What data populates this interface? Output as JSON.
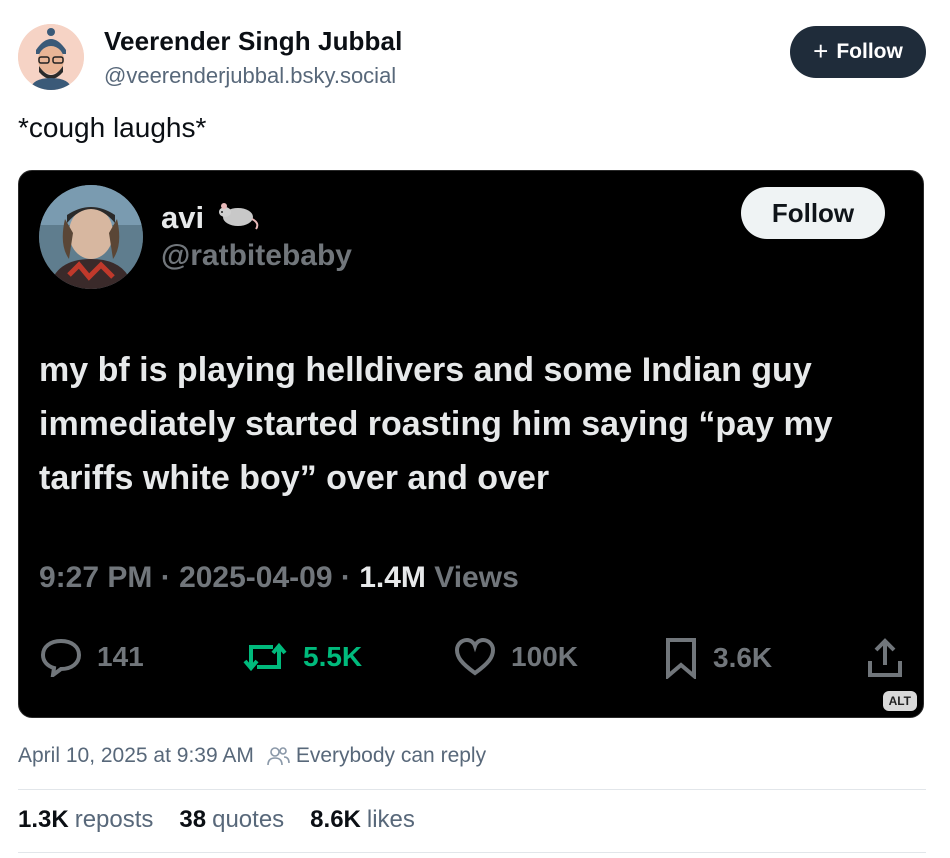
{
  "author": {
    "display_name": "Veerender Singh Jubbal",
    "handle": "@veerenderjubbal.bsky.social",
    "follow_label": "Follow"
  },
  "post": {
    "text": "*cough laughs*",
    "timestamp": "April 10, 2025 at 9:39 AM",
    "reply_setting": "Everybody can reply"
  },
  "embedded_tweet": {
    "name": "avi",
    "handle": "@ratbitebaby",
    "follow_label": "Follow",
    "text": "my bf is playing helldivers and some Indian guy immediately started roasting him saying “pay my tariffs white boy” over and over",
    "time": "9:27 PM",
    "date": "2025-04-09",
    "views_count": "1.4M",
    "views_label": "Views",
    "replies": "141",
    "reposts": "5.5K",
    "likes": "100K",
    "bookmarks": "3.6K",
    "alt_badge": "ALT",
    "colors": {
      "repost_green": "#00ba7c",
      "muted": "#71767b"
    }
  },
  "stats": {
    "reposts_count": "1.3K",
    "reposts_label": "reposts",
    "quotes_count": "38",
    "quotes_label": "quotes",
    "likes_count": "8.6K",
    "likes_label": "likes"
  },
  "icons": [
    "rat-emoji-icon",
    "reply-bubble-icon",
    "retweet-icon",
    "heart-icon",
    "bookmark-icon",
    "share-icon",
    "people-icon",
    "plus-icon"
  ]
}
